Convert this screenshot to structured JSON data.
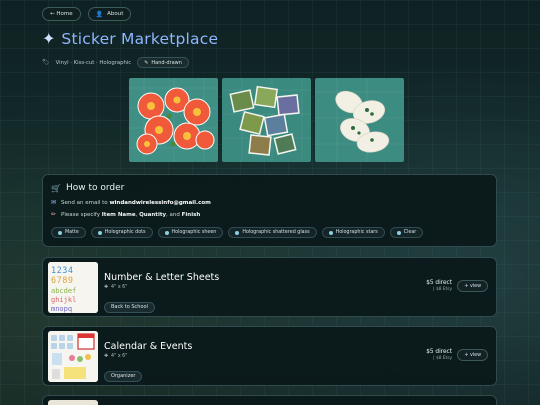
{
  "nav": {
    "home_label": "← Home",
    "about_label": "About"
  },
  "header": {
    "sparkle": "✦",
    "title": "Sticker Marketplace",
    "tags": "Vinyl · Kiss-cut · Holographic",
    "chip": "Hand-drawn"
  },
  "gallery": {
    "items": [
      "orange flower stickers",
      "square landscape stickers",
      "white oval stickers"
    ]
  },
  "howto": {
    "title": "How to order",
    "email_prefix": "Send an email to ",
    "email": "windandwirelessinfo@gmail.com",
    "specify_prefix": "Please specify ",
    "field1": "Item Name",
    "sep1": ", ",
    "field2": "Quantity",
    "sep2": ", and ",
    "field3": "Finish",
    "finishes": [
      "Matte",
      "Holographic dots",
      "Holographic sheen",
      "Holographic shattered glass",
      "Holographic stars",
      "Clear"
    ]
  },
  "products": [
    {
      "title": "Number & Letter Sheets",
      "size": "4\" x 6\"",
      "badge": "Back to School",
      "price": "$5 direct",
      "etsy": "| $8 Etsy",
      "view_label": "+ view"
    },
    {
      "title": "Calendar & Events",
      "size": "4\" x 6\"",
      "badge": "Organizer",
      "price": "$5 direct",
      "etsy": "| $8 Etsy",
      "view_label": "+ view"
    }
  ]
}
